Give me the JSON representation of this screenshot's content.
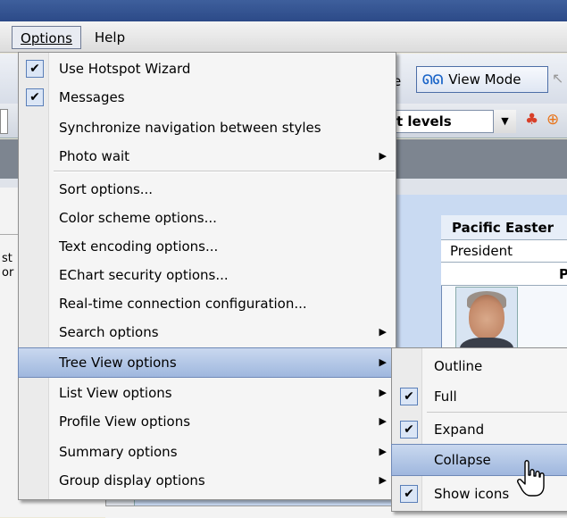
{
  "menubar": {
    "options": "Options",
    "help": "Help"
  },
  "toolbar": {
    "view_mode": "View Mode",
    "view_mode_fragment": "e",
    "levels": "t levels",
    "levels_arrow": "▼"
  },
  "left_panel": {
    "frag1": "st",
    "frag2": "or"
  },
  "chart": {
    "card_header": "Pacific Easter",
    "card_title": "President",
    "card_sub": "P"
  },
  "options_menu": {
    "items": [
      {
        "label": "Use Hotspot Wizard",
        "checked": true
      },
      {
        "label": "Messages",
        "checked": true
      },
      {
        "label": "Synchronize navigation between styles"
      },
      {
        "label": "Photo wait",
        "submenu": true
      },
      {
        "label": "Sort options..."
      },
      {
        "label": "Color scheme options..."
      },
      {
        "label": "Text encoding options..."
      },
      {
        "label": "EChart security options..."
      },
      {
        "label": "Real-time connection configuration..."
      },
      {
        "label": "Search options",
        "submenu": true
      },
      {
        "label": "Tree View options",
        "submenu": true,
        "highlighted": true
      },
      {
        "label": "List View options",
        "submenu": true
      },
      {
        "label": "Profile View options",
        "submenu": true
      },
      {
        "label": "Summary options",
        "submenu": true
      },
      {
        "label": "Group display options",
        "submenu": true
      }
    ]
  },
  "tree_view_submenu": {
    "items": [
      {
        "label": "Outline"
      },
      {
        "label": "Full",
        "checked": true
      },
      {
        "label": "Expand",
        "checked": true
      },
      {
        "label": "Collapse",
        "highlighted": true
      },
      {
        "label": "Show icons",
        "checked": true
      }
    ]
  },
  "glyphs": {
    "check": "✔",
    "arrow": "▶"
  }
}
